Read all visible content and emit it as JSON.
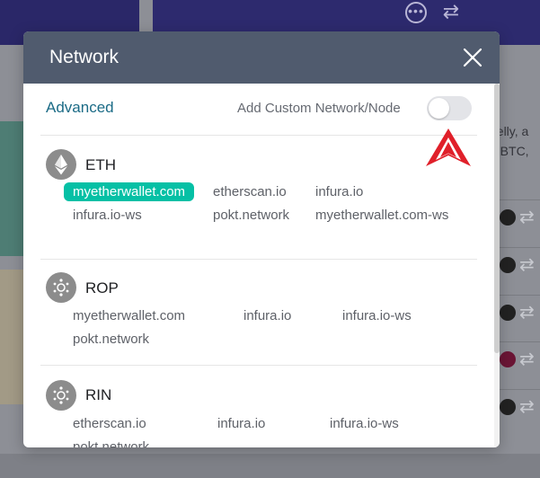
{
  "background": {
    "right_text_1": "gelly, a",
    "right_text_2": "d BTC,"
  },
  "modal": {
    "title": "Network",
    "advanced_label": "Advanced",
    "custom_network_label": "Add Custom Network/Node",
    "custom_network_enabled": false,
    "networks": [
      {
        "name": "ETH",
        "icon": "ethereum-icon",
        "nodes": [
          "myetherwallet.com",
          "etherscan.io",
          "infura.io",
          "infura.io-ws",
          "pokt.network",
          "myetherwallet.com-ws"
        ],
        "selected": "myetherwallet.com"
      },
      {
        "name": "ROP",
        "icon": "network-icon",
        "nodes": [
          "myetherwallet.com",
          "infura.io",
          "infura.io-ws",
          "pokt.network"
        ]
      },
      {
        "name": "RIN",
        "icon": "network-icon",
        "nodes": [
          "etherscan.io",
          "infura.io",
          "infura.io-ws",
          "pokt.network"
        ]
      }
    ]
  },
  "colors": {
    "header": "#505b6e",
    "accent": "#05c0a5",
    "advanced_text": "#1b6b86",
    "arrow_marker": "#e0202a"
  }
}
